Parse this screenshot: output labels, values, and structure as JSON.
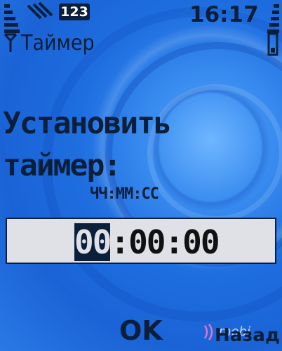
{
  "status_bar": {
    "time": "16:17",
    "badge": "123",
    "icons": [
      "signal-strength-icon",
      "message-icon",
      "battery-icon"
    ]
  },
  "header": {
    "title": "Таймер"
  },
  "content": {
    "prompt_line1": "Установить",
    "prompt_line2": "таймер:",
    "format_hint": "ЧЧ:ММ:СС",
    "time_value_cursor": "00",
    "time_value_rest": ":00:00"
  },
  "softkeys": {
    "left": "OK",
    "right": "Назад"
  },
  "watermark": {
    "text": "mobi"
  },
  "colors": {
    "text": "#0b1f3a",
    "background": "#1f6fe0",
    "field": "#dfe1e6"
  }
}
